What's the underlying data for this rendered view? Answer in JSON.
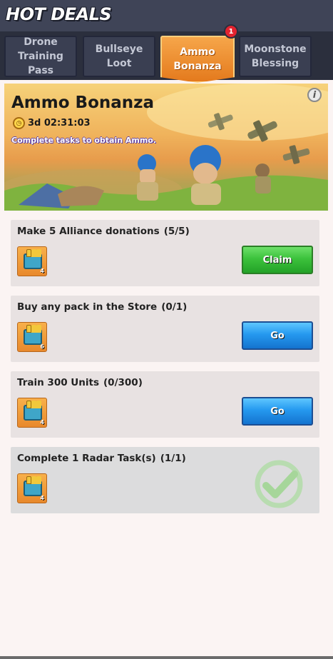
{
  "header": {
    "title": "HOT DEALS"
  },
  "tabs": [
    {
      "line1": "Drone",
      "line2": "Training Pass"
    },
    {
      "line1": "Bullseye",
      "line2": "Loot"
    },
    {
      "line1": "Ammo",
      "line2": "Bonanza"
    },
    {
      "line1": "Moonstone",
      "line2": "Blessing"
    }
  ],
  "active_tab_badge": "1",
  "banner": {
    "title": "Ammo Bonanza",
    "timer": "3d 02:31:03",
    "description": "Complete tasks to obtain Ammo."
  },
  "tasks": [
    {
      "label": "Make 5 Alliance donations",
      "progress": "(5/5)",
      "reward_count": "4",
      "action": "Claim",
      "status": "claimable"
    },
    {
      "label": "Buy any pack in the Store",
      "progress": "(0/1)",
      "reward_count": "6",
      "action": "Go",
      "status": "in-progress"
    },
    {
      "label": "Train 300 Units",
      "progress": "(0/300)",
      "reward_count": "4",
      "action": "Go",
      "status": "in-progress"
    },
    {
      "label": "Complete 1 Radar Task(s)",
      "progress": "(1/1)",
      "reward_count": "4",
      "action": "",
      "status": "completed"
    }
  ],
  "colors": {
    "claim_button": "#3cc23c",
    "go_button": "#2599ef",
    "active_tab": "#f0902f",
    "header_bg": "#3f4457"
  },
  "icons": [
    "timer-icon",
    "info-icon",
    "ammo-crate-icon",
    "checkmark-icon"
  ]
}
